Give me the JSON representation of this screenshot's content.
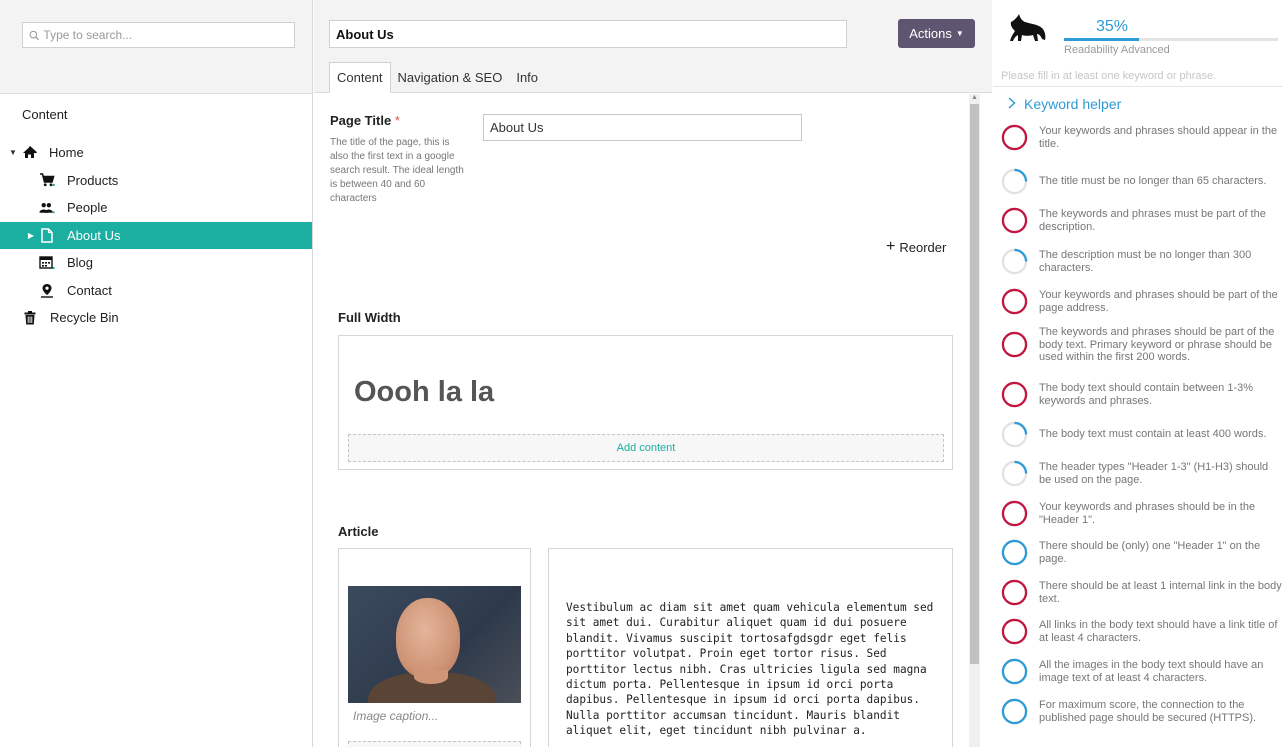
{
  "search": {
    "placeholder": "Type to search..."
  },
  "tree": {
    "title": "Content",
    "items": [
      {
        "label": "Home",
        "icon": "home-icon"
      },
      {
        "label": "Products",
        "icon": "cart-icon"
      },
      {
        "label": "People",
        "icon": "people-icon"
      },
      {
        "label": "About Us",
        "icon": "document-icon"
      },
      {
        "label": "Blog",
        "icon": "calendar-icon"
      },
      {
        "label": "Contact",
        "icon": "map-pin-icon"
      },
      {
        "label": "Recycle Bin",
        "icon": "trash-icon"
      }
    ]
  },
  "editor": {
    "name": "About Us",
    "actions_label": "Actions",
    "tabs": [
      "Content",
      "Navigation & SEO",
      "Info"
    ],
    "page_title": {
      "label": "Page Title",
      "required_mark": "*",
      "description": "The title of the page, this is also the first text in a google search result. The ideal length is between 40 and 60 characters",
      "value": "About Us"
    },
    "reorder_label": "Reorder",
    "full_width": {
      "label": "Full Width",
      "heading": "Oooh la la",
      "add_content": "Add content"
    },
    "article": {
      "label": "Article",
      "caption_placeholder": "Image caption...",
      "body": "Vestibulum ac diam sit amet quam vehicula elementum sed sit amet dui. Curabitur aliquet quam id dui posuere blandit. Vivamus suscipit tortosafgdsgdr eget felis porttitor volutpat. Proin eget tortor risus. Sed porttitor lectus nibh. Cras ultricies ligula sed magna dictum porta. Pellentesque in ipsum id orci porta dapibus. Pellentesque in ipsum id orci porta dapibus. Nulla porttitor accumsan tincidunt. Mauris blandit aliquet elit, eget tincidunt nibh pulvinar a."
    }
  },
  "seo": {
    "score": "35%",
    "score_fraction": 0.35,
    "subtitle": "Readability Advanced",
    "hint": "Please fill in at least one keyword or phrase.",
    "keyword_helper_label": "Keyword helper",
    "colors": {
      "fail": "#c0163f",
      "partial": "#2e9ad6",
      "accent": "#2e9ad6"
    },
    "checks": [
      {
        "text": "Your keywords and phrases should appear in the title.",
        "status": "fail"
      },
      {
        "text": "The title must be no longer than 65 characters.",
        "status": "partial"
      },
      {
        "text": "The keywords and phrases must be part of the description.",
        "status": "fail"
      },
      {
        "text": "The description must be no longer than 300 characters.",
        "status": "partial"
      },
      {
        "text": "Your keywords and phrases should be part of the page address.",
        "status": "fail"
      },
      {
        "text": "The keywords and phrases should be part of the body text. Primary keyword or phrase should be used within the first 200 words.",
        "status": "fail"
      },
      {
        "text": "The body text should contain between 1-3% keywords and phrases.",
        "status": "fail"
      },
      {
        "text": "The body text must contain at least 400 words.",
        "status": "partial"
      },
      {
        "text": "The header types \"Header 1-3\" (H1-H3) should be used on the page.",
        "status": "partial"
      },
      {
        "text": "Your keywords and phrases should be in the \"Header 1\".",
        "status": "fail"
      },
      {
        "text": "There should be (only) one \"Header 1\" on the page.",
        "status": "pass"
      },
      {
        "text": "There should be at least 1 internal link in the body text.",
        "status": "fail"
      },
      {
        "text": "All links in the body text should have a link title of at least 4 characters.",
        "status": "fail"
      },
      {
        "text": "All the images in the body text should have an image text of at least 4 characters.",
        "status": "pass"
      },
      {
        "text": "For maximum score, the connection to the published page should be secured (HTTPS).",
        "status": "pass"
      }
    ]
  }
}
